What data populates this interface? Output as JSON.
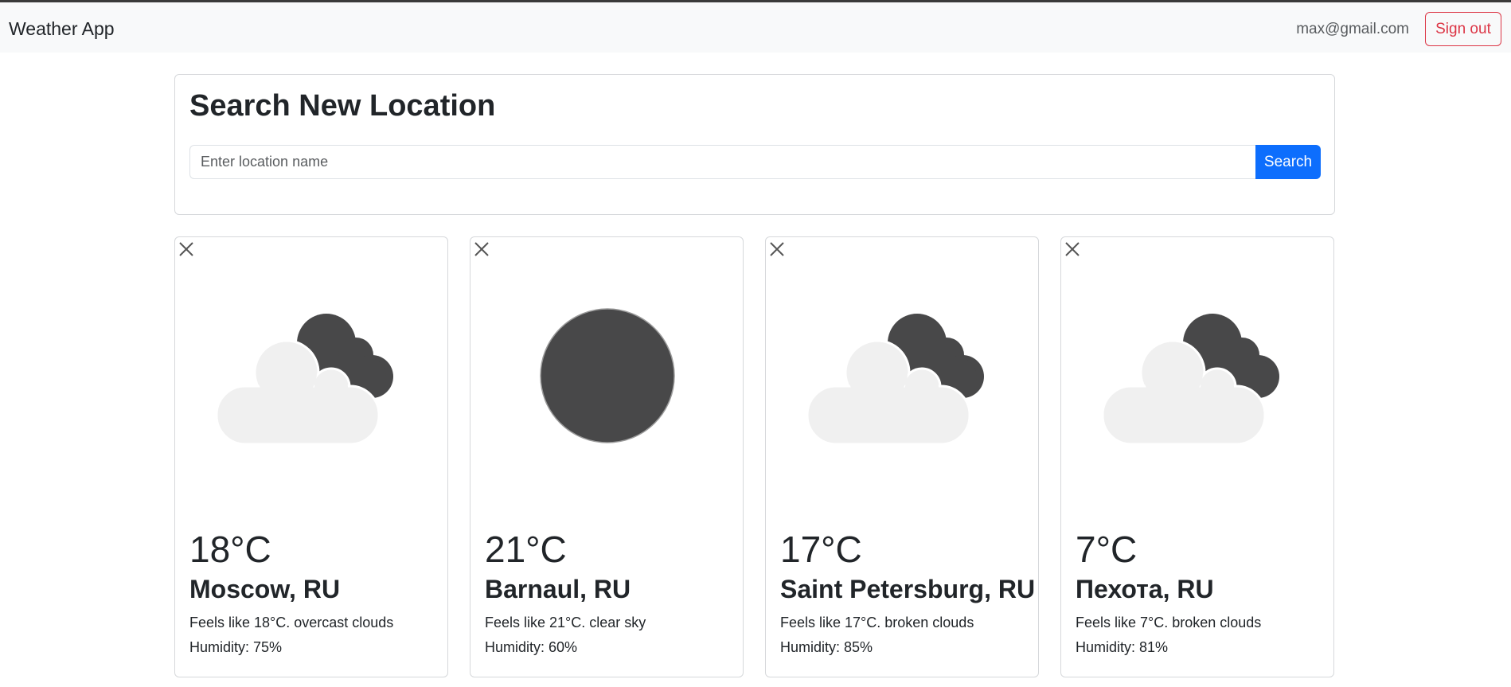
{
  "navbar": {
    "brand": "Weather App",
    "user_email": "max@gmail.com",
    "signout_label": "Sign out"
  },
  "search": {
    "title": "Search New Location",
    "placeholder": "Enter location name",
    "value": "",
    "button_label": "Search"
  },
  "colors": {
    "primary": "#0d6efd",
    "danger": "#dc3545",
    "icon_dark": "#484849",
    "icon_light": "#f0f0f0"
  },
  "cards": [
    {
      "temp": "18°C",
      "city": "Moscow, RU",
      "description": "Feels like 18°C. overcast clouds",
      "humidity": "Humidity: 75%",
      "icon": "overcast-clouds-icon"
    },
    {
      "temp": "21°C",
      "city": "Barnaul, RU",
      "description": "Feels like 21°C. clear sky",
      "humidity": "Humidity: 60%",
      "icon": "clear-sky-icon"
    },
    {
      "temp": "17°C",
      "city": "Saint Petersburg, RU",
      "description": "Feels like 17°C. broken clouds",
      "humidity": "Humidity: 85%",
      "icon": "broken-clouds-icon"
    },
    {
      "temp": "7°C",
      "city": "Пехота, RU",
      "description": "Feels like 7°C. broken clouds",
      "humidity": "Humidity: 81%",
      "icon": "broken-clouds-icon"
    }
  ]
}
